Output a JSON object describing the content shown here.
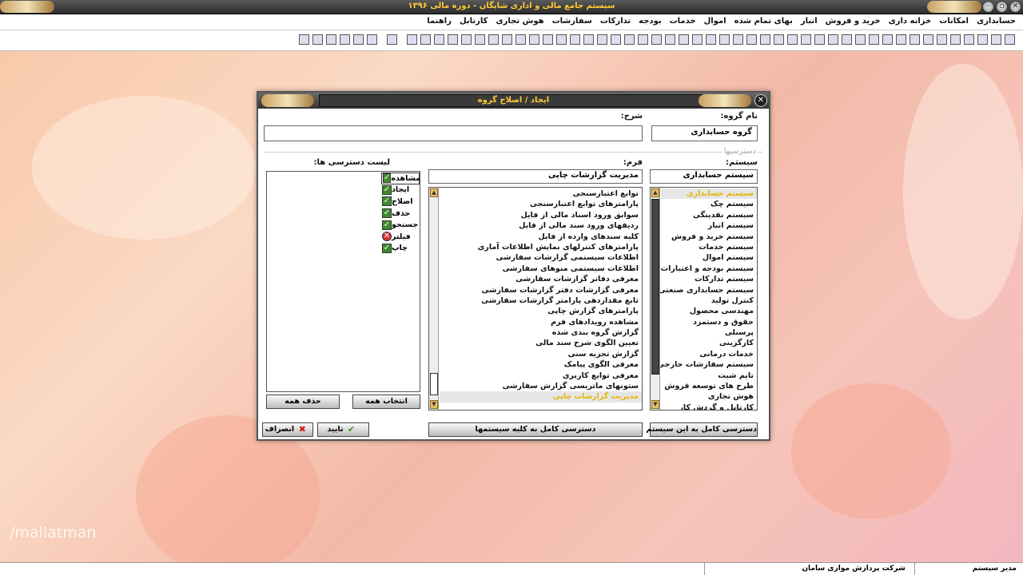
{
  "window": {
    "title": "سیستم جامع مالی و اداری شایگان - دوره مالی ۱۳۹۶"
  },
  "menu": [
    "حسابداری",
    "امکانات",
    "خزانه داری",
    "خرید و فروش",
    "انبار",
    "بهای تمام شده",
    "اموال",
    "خدمات",
    "بودجه",
    "تدارکات",
    "سفارشات",
    "هوش تجاری",
    "کارتابل",
    "راهنما"
  ],
  "dialog": {
    "title": "ایجاد / اصلاح گروه",
    "group_name_label": "نام گروه:",
    "group_name_value": "گروه حسابداری",
    "description_label": "شرح:",
    "description_value": "",
    "access_section_label": "دسترسیها",
    "system_label": "سیستم:",
    "system_value": "سیستم حسابداری",
    "form_label": "فرم:",
    "form_value": "مدیریت گزارشات چاپی",
    "access_list_label": "لیست دسترسی ها:",
    "access_header": "مشاهده",
    "systems": [
      "سیستم حسابداری",
      "سیستم چک",
      "سیستم نقدینگی",
      "سیستم انبار",
      "سیستم خرید و فروش",
      "سیستم خدمات",
      "سیستم اموال",
      "سیستم بودجه و اعتبارات",
      "سیستم تدارکات",
      "سیستم حسابداری صنعتی",
      "کنترل تولید",
      "مهندسی محصول",
      "حقوق و دستمزد",
      "پرسنلی",
      "کارگزینی",
      "خدمات درمانی",
      "سیستم سفارشات خارجی",
      "تایم شیت",
      "طرح های توسعه فروش",
      "هوش تجاری",
      "کارتابل و گردش کار"
    ],
    "forms": [
      "توابع اعتبارسنجی",
      "پارامترهای توابع اعتبارسنجی",
      "سوابق ورود اسناد مالی از فایل",
      "ردیفهای ورود سند مالی از فایل",
      "کلیه سندهای وارده از فایل",
      "پارامترهای کنترلهای نمایش اطلاعات آماری",
      "اطلاعات سیستمی گزارشات سفارشی",
      "اطلاعات سیستمی منوهای سفارشی",
      "معرفی دفاتر گزارشات سفارشی",
      "معرفی گزارشات دفتر گزارشات سفارشی",
      "تابع مقداردهی پارامتر گزارشات سفارشی",
      "پارامترهای گزارش چاپی",
      "مشاهده رویدادهای فرم",
      "گزارش گروه بندی شده",
      "تعیین الگوی شرح سند مالی",
      "گزارش تجزیه سنی",
      "معرفی الگوی پیامک",
      "معرفی توابع کاربری",
      "ستونهای ماتریسی گزارش سفارشی",
      "مدیریت گزارشات چاپی"
    ],
    "permissions": [
      {
        "label": "ایجاد",
        "granted": true
      },
      {
        "label": "اصلاح",
        "granted": true
      },
      {
        "label": "حذف",
        "granted": true
      },
      {
        "label": "جستجو",
        "granted": true
      },
      {
        "label": "فیلتر",
        "granted": false
      },
      {
        "label": "چاپ",
        "granted": true
      }
    ],
    "btn_select_all": "انتخاب همه",
    "btn_delete_all": "حذف همه",
    "btn_full_system": "دسترسی کامل به این سیستم",
    "btn_full_all": "دسترسی کامل به کلیه سیستمها",
    "btn_ok": "تایید",
    "btn_cancel": "انصراف"
  },
  "status": {
    "user": "مدیر سیستم",
    "company": "شرکت پردازش موازی سامان"
  },
  "watermark": "/maliatman",
  "colors": {
    "accent": "#ffcc33",
    "selected_text": "#e8b400",
    "check": "#3d8c2a",
    "deny": "#e03030"
  }
}
